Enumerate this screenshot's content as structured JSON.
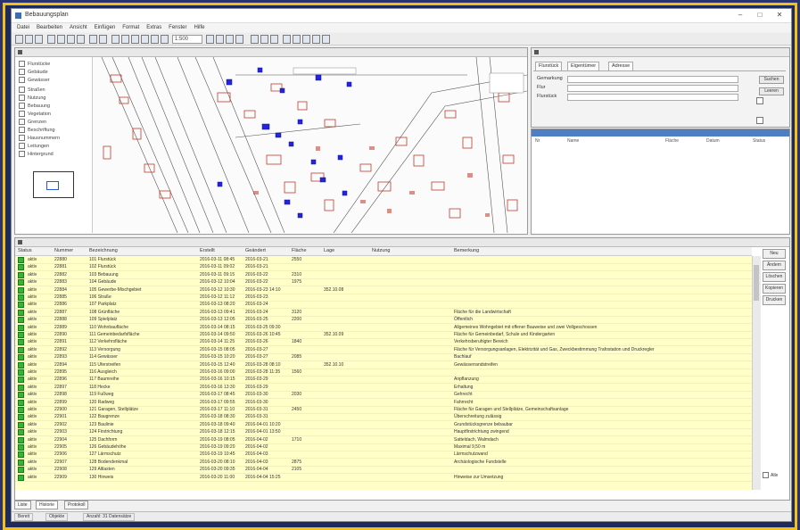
{
  "window": {
    "title": "Bebauungsplan",
    "minimize": "–",
    "maximize": "□",
    "close": "✕"
  },
  "menu": [
    "Datei",
    "Bearbeiten",
    "Ansicht",
    "Einfügen",
    "Format",
    "Extras",
    "Fenster",
    "Hilfe"
  ],
  "toolbar": {
    "scale_value": "1:500"
  },
  "map_panel": {
    "legend_items": [
      {
        "label": "Flurstücke"
      },
      {
        "label": "Gebäude"
      },
      {
        "label": "Gewässer"
      },
      {
        "label": "Straßen"
      },
      {
        "label": "Nutzung"
      },
      {
        "label": "Bebauung"
      },
      {
        "label": "Vegetation"
      },
      {
        "label": "Grenzen"
      },
      {
        "label": "Beschriftung"
      },
      {
        "label": "Hausnummern"
      },
      {
        "label": "Leitungen"
      },
      {
        "label": "Hintergrund"
      }
    ]
  },
  "search_panel": {
    "tabs": [
      "Flurstück",
      "Eigentümer",
      "Adresse"
    ],
    "fields": [
      {
        "label": "Gemarkung"
      },
      {
        "label": "Flur"
      },
      {
        "label": "Flurstück"
      }
    ],
    "buttons": [
      "Suchen",
      "Leeren"
    ]
  },
  "results_panel": {
    "columns": [
      "Nr",
      "Name",
      "Fläche",
      "Datum",
      "Status"
    ]
  },
  "list_panel": {
    "columns": [
      "Status",
      "Nummer",
      "Bezeichnung",
      "Erstellt",
      "Geändert",
      "Fläche",
      "Lage",
      "Nutzung",
      "Bemerkung"
    ],
    "rows": [
      {
        "status": "aktiv",
        "nummer": "22880",
        "bez": "101 Flurstück",
        "erst": "2016-03-11 08:45",
        "gea": "2016-03-21",
        "fl": "2550",
        "lage": "",
        "bem": ""
      },
      {
        "status": "aktiv",
        "nummer": "22881",
        "bez": "102 Flurstück",
        "erst": "2016-03-11 09:02",
        "gea": "2016-03-21",
        "fl": "",
        "lage": "",
        "bem": ""
      },
      {
        "status": "aktiv",
        "nummer": "22882",
        "bez": "103 Bebauung",
        "erst": "2016-03-11 09:15",
        "gea": "2016-03-22",
        "fl": "2310",
        "lage": "",
        "bem": ""
      },
      {
        "status": "aktiv",
        "nummer": "22883",
        "bez": "104 Gebäude",
        "erst": "2016-03-12 10:04",
        "gea": "2016-03-22",
        "fl": "1975",
        "lage": "",
        "bem": ""
      },
      {
        "status": "aktiv",
        "nummer": "22884",
        "bez": "105 Gewerbe-Mischgebiet",
        "erst": "2016-03-12 10:30",
        "gea": "2016-03-23 14:10",
        "fl": "",
        "lage": "352.10.08",
        "bem": ""
      },
      {
        "status": "aktiv",
        "nummer": "22885",
        "bez": "106 Straße",
        "erst": "2016-03-12 11:12",
        "gea": "2016-03-23",
        "fl": "",
        "lage": "",
        "bem": ""
      },
      {
        "status": "aktiv",
        "nummer": "22886",
        "bez": "107 Parkplatz",
        "erst": "2016-03-13 08:20",
        "gea": "2016-03-24",
        "fl": "",
        "lage": "",
        "bem": ""
      },
      {
        "status": "aktiv",
        "nummer": "22887",
        "bez": "108 Grünfläche",
        "erst": "2016-03-13 09:41",
        "gea": "2016-03-24",
        "fl": "3120",
        "lage": "",
        "bem": "Fläche für die Landwirtschaft"
      },
      {
        "status": "aktiv",
        "nummer": "22888",
        "bez": "109 Spielplatz",
        "erst": "2016-03-13 12:05",
        "gea": "2016-03-25",
        "fl": "2200",
        "lage": "",
        "bem": "Öffentlich"
      },
      {
        "status": "aktiv",
        "nummer": "22889",
        "bez": "110 Wohnbaufläche",
        "erst": "2016-03-14 08:15",
        "gea": "2016-03-25 09:30",
        "fl": "",
        "lage": "",
        "bem": "Allgemeines Wohngebiet mit offener Bauweise und zwei Vollgeschossen"
      },
      {
        "status": "aktiv",
        "nummer": "22890",
        "bez": "111 Gemeinbedarfsfläche",
        "erst": "2016-03-14 09:50",
        "gea": "2016-03-26 10:45",
        "fl": "",
        "lage": "352.10.09",
        "bem": "Fläche für Gemeinbedarf, Schule und Kindergarten"
      },
      {
        "status": "aktiv",
        "nummer": "22891",
        "bez": "112 Verkehrsfläche",
        "erst": "2016-03-14 11:25",
        "gea": "2016-03-26",
        "fl": "1840",
        "lage": "",
        "bem": "Verkehrsberuhigter Bereich"
      },
      {
        "status": "aktiv",
        "nummer": "22892",
        "bez": "113 Versorgung",
        "erst": "2016-03-15 08:05",
        "gea": "2016-03-27",
        "fl": "",
        "lage": "",
        "bem": "Fläche für Versorgungsanlagen, Elektrizität und Gas, Zweckbestimmung Trafostation und Druckregler"
      },
      {
        "status": "aktiv",
        "nummer": "22893",
        "bez": "114 Gewässer",
        "erst": "2016-03-15 10:20",
        "gea": "2016-03-27",
        "fl": "2085",
        "lage": "",
        "bem": "Bachlauf"
      },
      {
        "status": "aktiv",
        "nummer": "22894",
        "bez": "115 Uferstreifen",
        "erst": "2016-03-15 12:40",
        "gea": "2016-03-28 08:10",
        "fl": "",
        "lage": "352.10.10",
        "bem": "Gewässerrandstreifen"
      },
      {
        "status": "aktiv",
        "nummer": "22895",
        "bez": "116 Ausgleich",
        "erst": "2016-03-16 09:00",
        "gea": "2016-03-28 11:35",
        "fl": "1560",
        "lage": "",
        "bem": ""
      },
      {
        "status": "aktiv",
        "nummer": "22896",
        "bez": "117 Baumreihe",
        "erst": "2016-03-16 10:15",
        "gea": "2016-03-29",
        "fl": "",
        "lage": "",
        "bem": "Anpflanzung"
      },
      {
        "status": "aktiv",
        "nummer": "22897",
        "bez": "118 Hecke",
        "erst": "2016-03-16 13:30",
        "gea": "2016-03-29",
        "fl": "",
        "lage": "",
        "bem": "Erhaltung"
      },
      {
        "status": "aktiv",
        "nummer": "22898",
        "bez": "119 Fußweg",
        "erst": "2016-03-17 08:45",
        "gea": "2016-03-30",
        "fl": "2030",
        "lage": "",
        "bem": "Gehrecht"
      },
      {
        "status": "aktiv",
        "nummer": "22899",
        "bez": "120 Radweg",
        "erst": "2016-03-17 09:55",
        "gea": "2016-03-30",
        "fl": "",
        "lage": "",
        "bem": "Fahrrecht"
      },
      {
        "status": "aktiv",
        "nummer": "22900",
        "bez": "121 Garagen, Stellplätze",
        "erst": "2016-03-17 11:10",
        "gea": "2016-03-31",
        "fl": "2450",
        "lage": "",
        "bem": "Fläche für Garagen und Stellplätze, Gemeinschaftsanlage"
      },
      {
        "status": "aktiv",
        "nummer": "22901",
        "bez": "122 Baugrenze",
        "erst": "2016-03-18 08:30",
        "gea": "2016-03-31",
        "fl": "",
        "lage": "",
        "bem": "Überschreitung zulässig"
      },
      {
        "status": "aktiv",
        "nummer": "22902",
        "bez": "123 Baulinie",
        "erst": "2016-03-18 09:40",
        "gea": "2016-04-01 10:20",
        "fl": "",
        "lage": "",
        "bem": "Grundstücksgrenze bebaubar"
      },
      {
        "status": "aktiv",
        "nummer": "22903",
        "bez": "124 Firstrichtung",
        "erst": "2016-03-18 12:15",
        "gea": "2016-04-01 13:50",
        "fl": "",
        "lage": "",
        "bem": "Hauptfirstrichtung zwingend"
      },
      {
        "status": "aktiv",
        "nummer": "22904",
        "bez": "125 Dachform",
        "erst": "2016-03-19 08:05",
        "gea": "2016-04-02",
        "fl": "1710",
        "lage": "",
        "bem": "Satteldach, Walmdach"
      },
      {
        "status": "aktiv",
        "nummer": "22905",
        "bez": "126 Gebäudehöhe",
        "erst": "2016-03-19 09:20",
        "gea": "2016-04-02",
        "fl": "",
        "lage": "",
        "bem": "Maximal 9,50 m"
      },
      {
        "status": "aktiv",
        "nummer": "22906",
        "bez": "127 Lärmschutz",
        "erst": "2016-03-19 10:45",
        "gea": "2016-04-03",
        "fl": "",
        "lage": "",
        "bem": "Lärmschutzwand"
      },
      {
        "status": "aktiv",
        "nummer": "22907",
        "bez": "128 Bodendenkmal",
        "erst": "2016-03-20 08:10",
        "gea": "2016-04-03",
        "fl": "2875",
        "lage": "",
        "bem": "Archäologische Fundstelle"
      },
      {
        "status": "aktiv",
        "nummer": "22908",
        "bez": "129 Altlasten",
        "erst": "2016-03-20 09:35",
        "gea": "2016-04-04",
        "fl": "2105",
        "lage": "",
        "bem": ""
      },
      {
        "status": "aktiv",
        "nummer": "22909",
        "bez": "130 Hinweis",
        "erst": "2016-03-20 11:00",
        "gea": "2016-04-04 15:25",
        "fl": "",
        "lage": "",
        "bem": "Hinweise zur Umsetzung"
      }
    ],
    "side_buttons": [
      "Neu",
      "Ändern",
      "Löschen",
      "Kopieren",
      "Drucken"
    ],
    "side_check": "Alle"
  },
  "bottom_tabs": [
    "Liste",
    "Historie",
    "Protokoll"
  ],
  "status": {
    "cell1": "Bereit",
    "cell2": "Objekte",
    "cell3": "Anzahl: 31 Datensätze"
  },
  "colors": {
    "row_bg": "#ffffc8",
    "status_ok": "#35b435",
    "accent": "#4e7fc4",
    "frame": "#f4c018"
  }
}
